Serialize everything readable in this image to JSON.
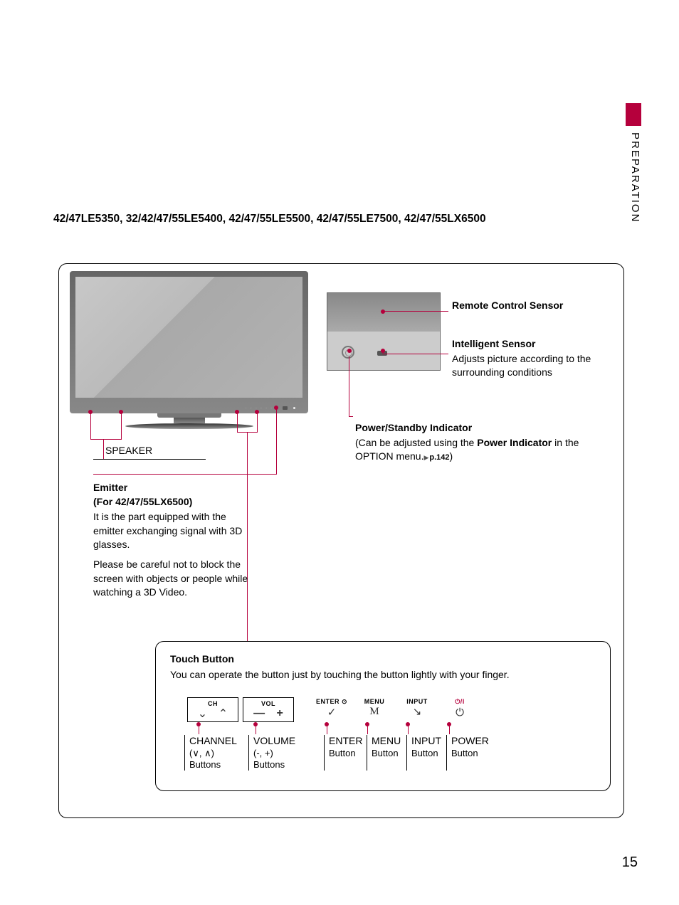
{
  "side": {
    "label": "PREPARATION"
  },
  "heading": "42/47LE5350, 32/42/47/55LE5400, 42/47/55LE5500, 42/47/55LE7500, 42/47/55LX6500",
  "speaker": {
    "label": "SPEAKER"
  },
  "emitter": {
    "title1": "Emitter",
    "title2": "(For 42/47/55LX6500)",
    "p1": "It is the part equipped with the emitter exchanging signal with 3D glasses.",
    "p2": "Please be careful not to block the screen with objects or people while watching a 3D Video."
  },
  "inset": {
    "rcs_title": "Remote Control Sensor",
    "is_title": "Intelligent Sensor",
    "is_body": "Adjusts picture according to the surrounding conditions",
    "psi_title": "Power/Standby Indicator",
    "psi_body_pre": "(Can be adjusted using the ",
    "psi_body_bold": "Power Indicator",
    "psi_body_post": " in the OPTION menu.",
    "psi_ref": "p.142",
    "psi_close": ")"
  },
  "touch": {
    "title": "Touch Button",
    "desc": "You can operate the button just by touching the button lightly with your finger.",
    "buttons": {
      "ch": {
        "label": "CH",
        "desc_title": "CHANNEL",
        "desc_sub": "(∨, ∧)",
        "desc_sub2": "Buttons"
      },
      "vol": {
        "label": "VOL",
        "desc_title": "VOLUME",
        "desc_sub": "(-, +)",
        "desc_sub2": "Buttons"
      },
      "enter": {
        "label": "ENTER ⊙",
        "desc_title": "ENTER",
        "desc_sub": "Button"
      },
      "menu": {
        "label": "MENU",
        "desc_title": "MENU",
        "desc_sub": "Button"
      },
      "input": {
        "label": "INPUT",
        "desc_title": "INPUT",
        "desc_sub": "Button"
      },
      "power": {
        "label": "⏻/I",
        "desc_title": "POWER",
        "desc_sub": "Button"
      }
    }
  },
  "page_number": "15"
}
